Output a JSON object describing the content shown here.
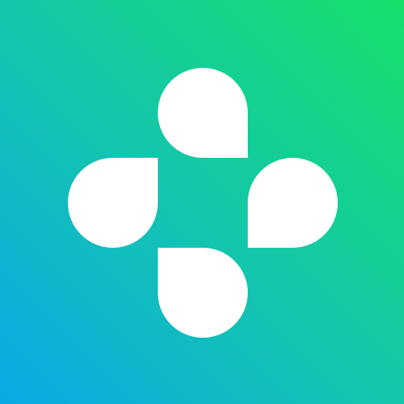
{
  "icon": {
    "name": "four-petal-logo-icon",
    "gradient_start": "#0aa8e6",
    "gradient_mid": "#13c4b0",
    "gradient_end": "#16e06a",
    "petal_color": "#ffffff"
  }
}
